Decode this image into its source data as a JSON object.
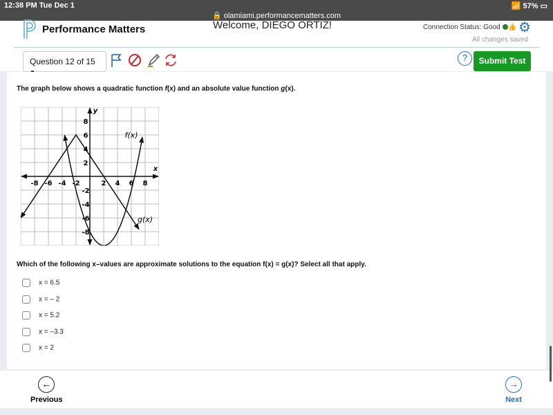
{
  "status_bar": {
    "time": "12:38 PM  Tue Dec 1",
    "url": "olamiami.performancematters.com",
    "battery": "57%"
  },
  "header": {
    "brand": "Performance Matters",
    "welcome": "Welcome, DIEGO ORTIZ!",
    "connection": "Connection Status: Good",
    "saved": "All changes saved"
  },
  "toolbar": {
    "question_selector": "Question 12 of 15",
    "help": "?",
    "submit": "Submit Test"
  },
  "question": {
    "prompt_pre": "The graph below shows a quadratic function ",
    "prompt_f": "f",
    "prompt_mid": "(x) and an absolute value function ",
    "prompt_g": "g",
    "prompt_end": "(x).",
    "q2": "Which of the following x–values are approximate solutions to the equation f(x) = g(x)? Select all that apply.",
    "options": [
      "x = 6.5",
      "x = – 2",
      "x = 5.2",
      "x = –3.3",
      "x = 2"
    ]
  },
  "graph": {
    "x_label": "x",
    "y_label": "y",
    "f_label": "f(x)",
    "g_label": "g(x)",
    "x_ticks": [
      "-8",
      "-6",
      "-4",
      "-2",
      "2",
      "4",
      "6",
      "8"
    ],
    "y_ticks": [
      "8",
      "6",
      "4",
      "2",
      "-2",
      "-4",
      "-6",
      "-8"
    ]
  },
  "footer": {
    "previous": "Previous",
    "next": "Next"
  },
  "colors": {
    "submit": "#169b22",
    "accent": "#2a6fb5"
  }
}
